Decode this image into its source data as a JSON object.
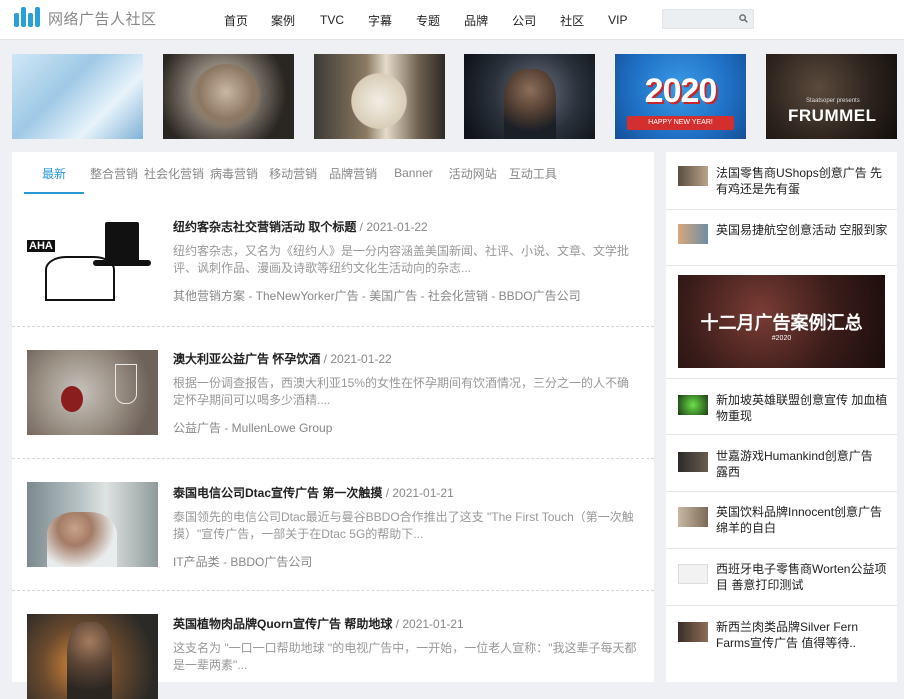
{
  "site": {
    "logo_text": "网络广告人社区",
    "brand_color": "#2aa0d8"
  },
  "nav": {
    "items": [
      "首页",
      "案例",
      "TVC",
      "字幕",
      "专题",
      "品牌",
      "公司",
      "社区",
      "VIP"
    ]
  },
  "search": {
    "placeholder": ""
  },
  "banners": {
    "new_year": {
      "year": "2020",
      "ribbon": "HAPPY NEW YEAR!"
    },
    "frummel": {
      "presents": "Staatsoper presents",
      "brand": "FRUMMEL"
    }
  },
  "tabs": [
    "最新",
    "整合营销",
    "社会化营销",
    "病毒营销",
    "移动营销",
    "品牌营销",
    "Banner",
    "活动网站",
    "互动工具"
  ],
  "articles": [
    {
      "title": "纽约客杂志社交营销活动 取个标题",
      "date": " / 2021-01-22",
      "desc": "纽约客杂志，又名为《纽约人》是一分内容涵盖美国新闻、社评、小说、文章、文学批评、讽刺作品、漫画及诗歌等纽约文化生活动向的杂志...",
      "tags": "其他营销方案 - TheNewYorker广告 - 美国广告 - 社会化营销 - BBDO广告公司",
      "thumb_text": "AHA"
    },
    {
      "title": "澳大利亚公益广告 怀孕饮酒",
      "date": " / 2021-01-22",
      "desc": "根据一份调查报告，西澳大利亚15%的女性在怀孕期间有饮酒情况，三分之一的人不确定怀孕期间可以喝多少酒精....",
      "tags": "公益广告 - MullenLowe Group"
    },
    {
      "title": "泰国电信公司Dtac宣传广告 第一次触摸",
      "date": " / 2021-01-21",
      "desc": "泰国领先的电信公司Dtac最近与曼谷BBDO合作推出了这支 \"The First Touch（第一次触摸）\"宣传广告，一部关于在Dtac 5G的帮助下...",
      "tags": "IT产品类 - BBDO广告公司"
    },
    {
      "title": "英国植物肉品牌Quorn宣传广告 帮助地球",
      "date": " / 2021-01-21",
      "desc": "这支名为 \"一口一口帮助地球 \"的电视广告中，一开始，一位老人宣称：\"我这辈子每天都是一辈两素\"...",
      "tags": ""
    }
  ],
  "sidebar": {
    "items": [
      "法国零售商UShops创意广告 先有鸡还是先有蛋",
      "英国易捷航空创意活动 空服到家",
      "新加坡英雄联盟创意宣传 加血植物重现",
      "世嘉游戏Humankind创意广告 露西",
      "英国饮料品牌Innocent创意广告 绵羊的自白",
      "西班牙电子零售商Worten公益项目 善意打印测试",
      "新西兰肉类品牌Silver Fern Farms宣传广告 值得等待.."
    ],
    "feature": {
      "title": "十二月广告案例汇总",
      "year": "#2020"
    }
  }
}
